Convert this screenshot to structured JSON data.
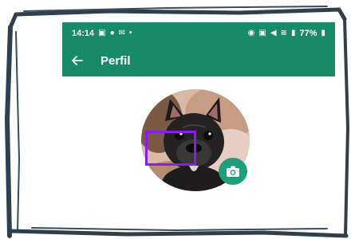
{
  "status_bar": {
    "time": "14:14",
    "battery": "77%"
  },
  "app_bar": {
    "title": "Perfil",
    "back_icon": "arrow-left-icon"
  },
  "profile": {
    "avatar_icon": "profile-photo",
    "camera_icon": "camera-icon"
  },
  "colors": {
    "app_bar": "#178a68",
    "camera_button": "#1e9e7a",
    "highlight": "#8a1cf0"
  }
}
